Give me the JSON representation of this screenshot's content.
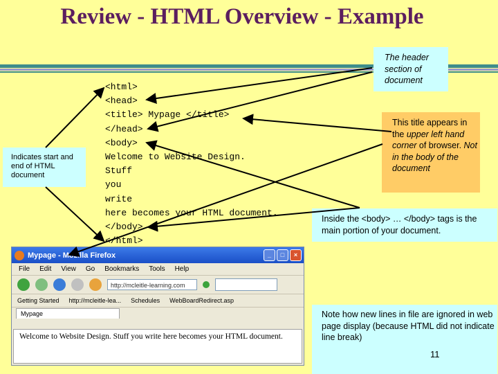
{
  "slide": {
    "title": "Review - HTML Overview - Example",
    "page_number": "11"
  },
  "code_lines": [
    "<html>",
    "<head>",
    "<title> Mypage </title>",
    "</head>",
    "<body>",
    "Welcome to Website Design.",
    "Stuff",
    "you",
    "write",
    "here becomes your HTML document.",
    "</body>",
    "</html>"
  ],
  "callouts": {
    "start_end": "Indicates start and end of HTML document",
    "header": "The header section of document",
    "title_a": "This title appears in the ",
    "title_b": "upper left hand corner",
    "title_c": " of browser. ",
    "title_d": "Not in the body of the document",
    "body": "Inside the <body> … </body> tags is the main portion of your document.",
    "note": "Note how new lines in file are ignored in web page display (because HTML did not indicate line break)"
  },
  "browser": {
    "window_title": "Mypage - Mozilla Firefox",
    "menu": [
      "File",
      "Edit",
      "View",
      "Go",
      "Bookmarks",
      "Tools",
      "Help"
    ],
    "url": "http://mcleitle-learning.com",
    "bookmarks": [
      "Getting Started",
      "http://mcleitle-lea...",
      "Schedules",
      "WebBoardRedirect.asp"
    ],
    "tab": "Mypage",
    "content": "Welcome to Website Design. Stuff you write here becomes your HTML document."
  },
  "colors": {
    "background": "#FFFF99",
    "title": "#5B1E5F",
    "callout_teal": "#CCFFFF",
    "callout_orange": "#FFCC66"
  }
}
